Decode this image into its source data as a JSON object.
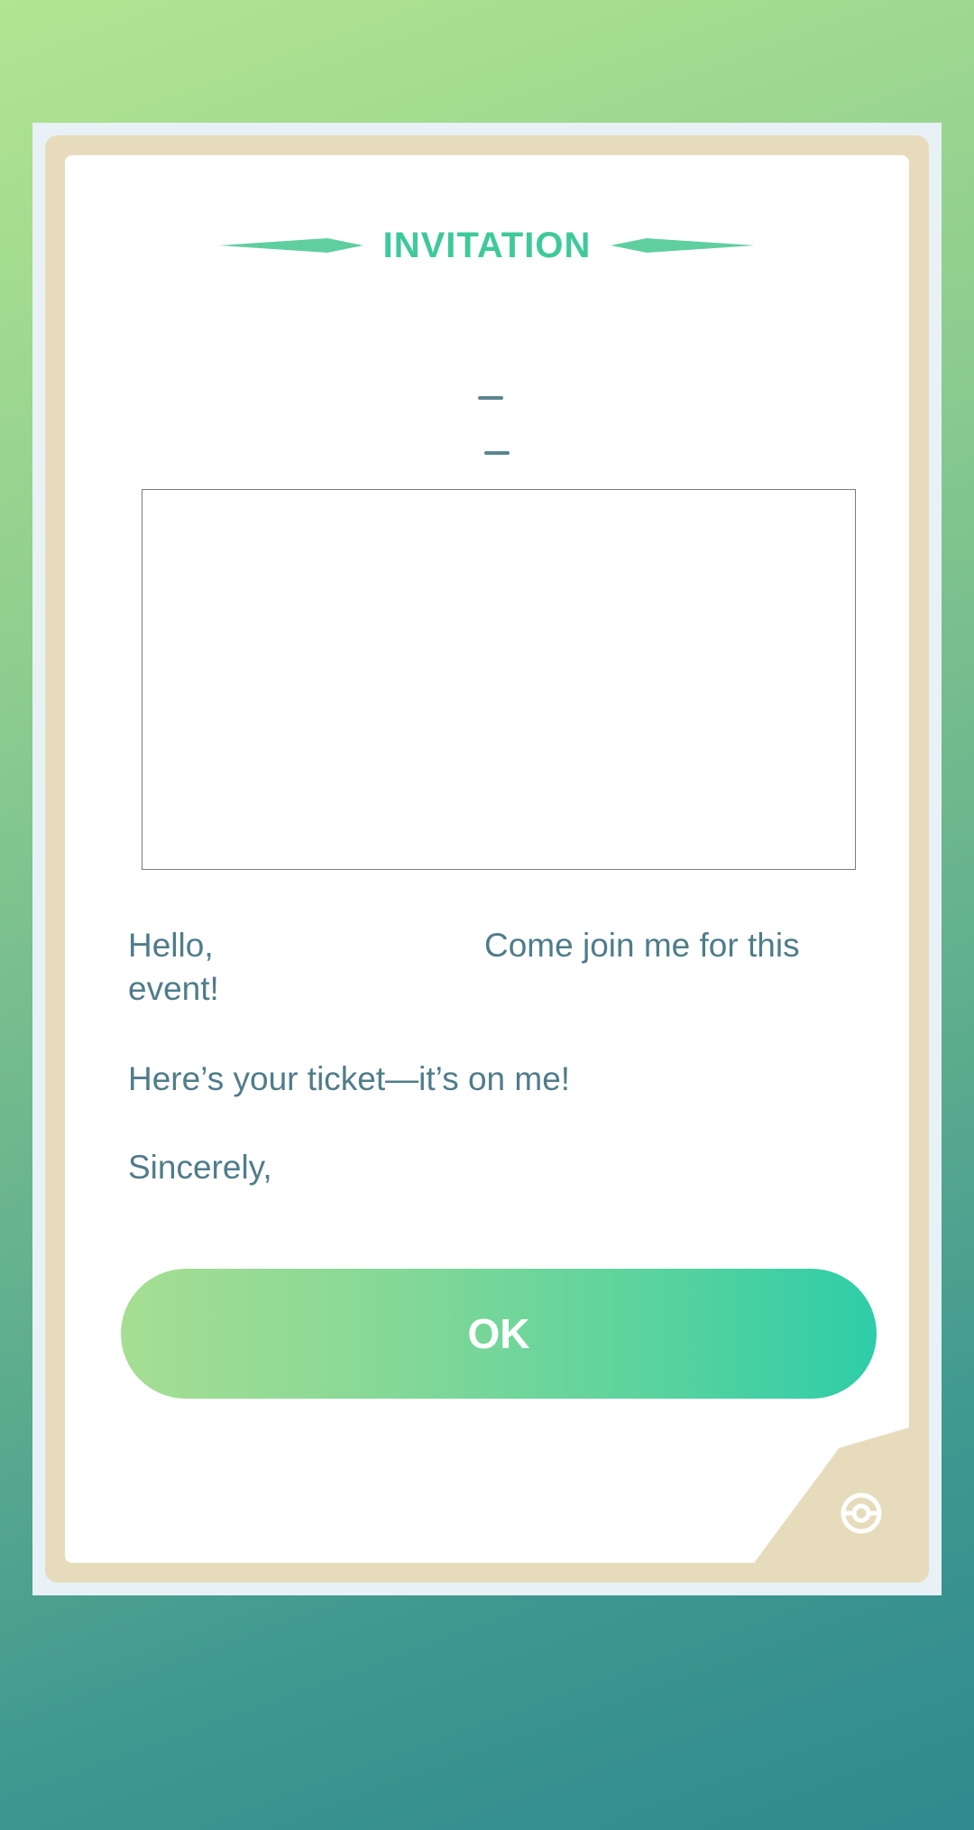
{
  "dialog": {
    "title": "INVITATION",
    "message": {
      "greeting": "Hello,",
      "join_text": "Come join me for this",
      "join_text_cont": "event!",
      "ticket_text": "Here’s your ticket—it’s on me!",
      "closing": "Sincerely,"
    },
    "ok_label": "OK"
  },
  "colors": {
    "title": "#3ec99a",
    "body_text": "#4f7c8a",
    "frame": "#e6dcbc",
    "button_start": "#a6de93",
    "button_end": "#2ecda8"
  },
  "icons": {
    "corner": "pokeball-icon",
    "title_decorations": "diamond-bar-icon"
  }
}
